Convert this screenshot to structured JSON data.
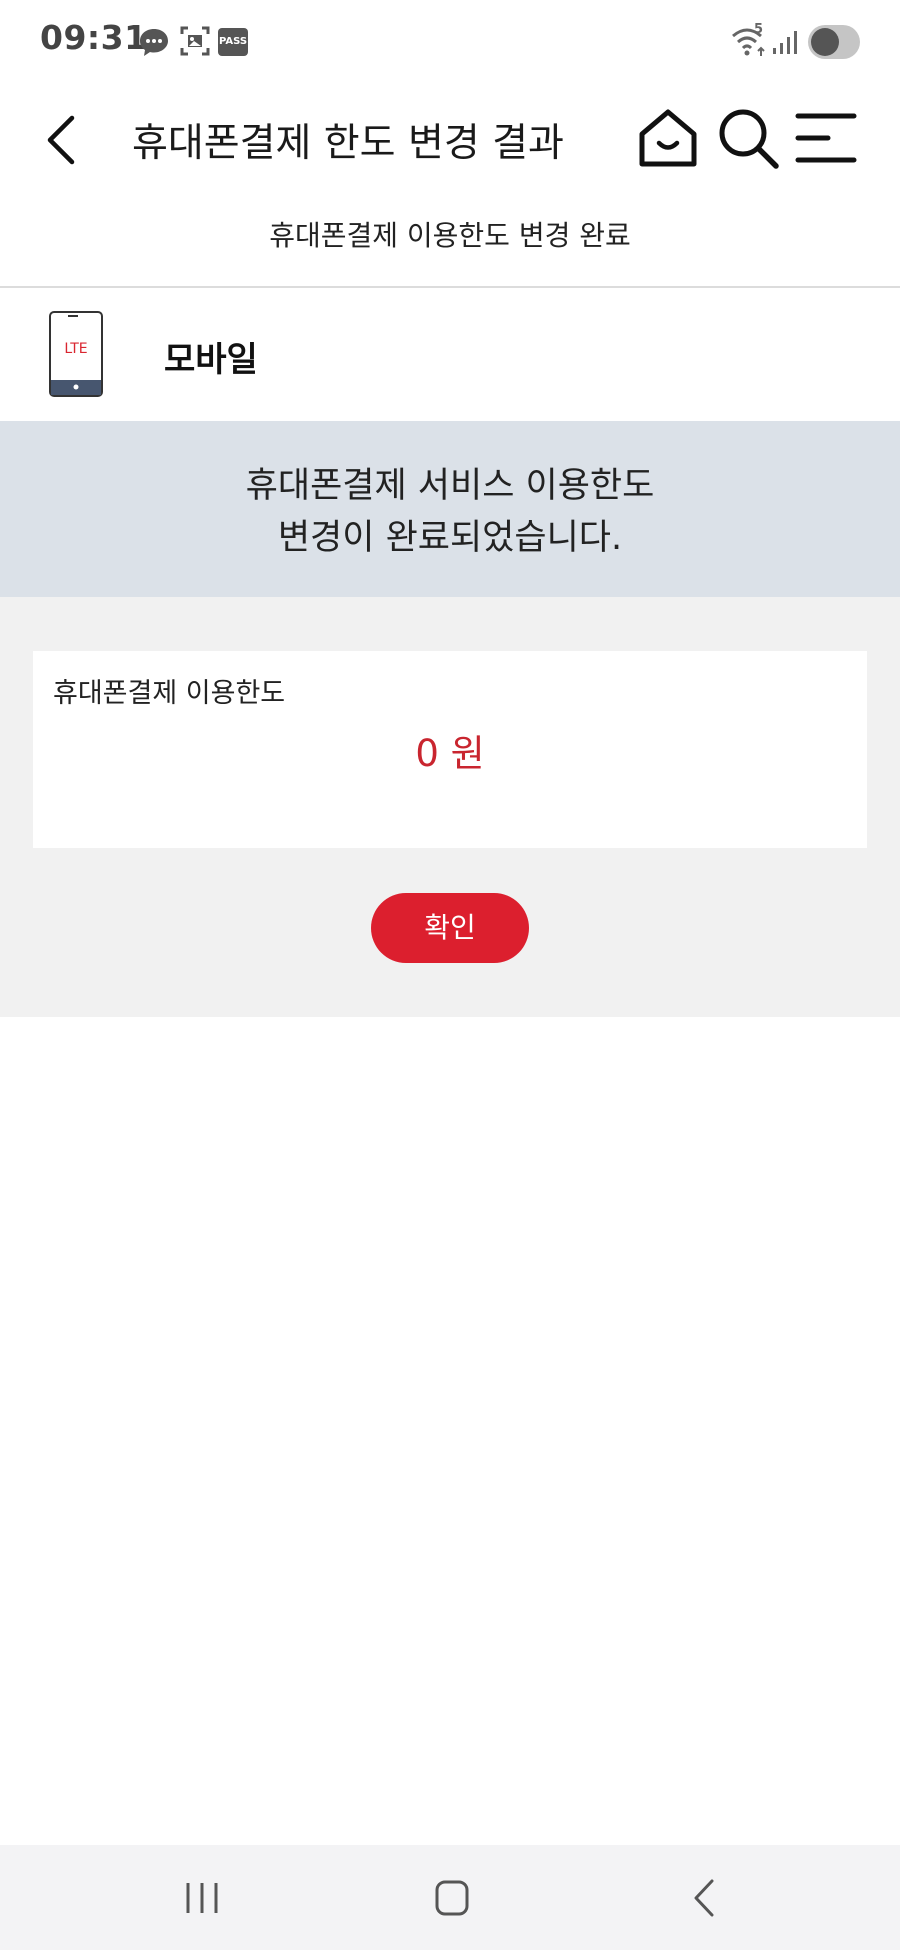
{
  "status_bar": {
    "time": "09:31",
    "notification_icons": [
      "chat-bubble-icon",
      "gallery-icon",
      "pass-app-icon"
    ],
    "pass_label": "PASS",
    "wifi_label": "5",
    "system_icons": [
      "wifi-icon",
      "signal-icon",
      "toggle-icon"
    ]
  },
  "header": {
    "title": "휴대폰결제 한도 변경 결과",
    "icons": [
      "back-icon",
      "home-icon",
      "search-icon",
      "menu-icon"
    ]
  },
  "subtitle": "휴대폰결제 이용한도 변경 완료",
  "device": {
    "icon": "lte-phone-icon",
    "icon_label": "LTE",
    "name": "모바일"
  },
  "banner": {
    "line1": "휴대폰결제 서비스 이용한도",
    "line2": "변경이 완료되었습니다."
  },
  "limit": {
    "label": "휴대폰결제 이용한도",
    "value": "0 원"
  },
  "confirm_label": "확인",
  "nav": {
    "icons": [
      "recent-apps-icon",
      "home-nav-icon",
      "back-nav-icon"
    ]
  },
  "colors": {
    "accent": "#dc1f2e",
    "value_red": "#c9252f",
    "banner_bg": "#dbe1e8",
    "gray_bg": "#f1f1f1"
  }
}
